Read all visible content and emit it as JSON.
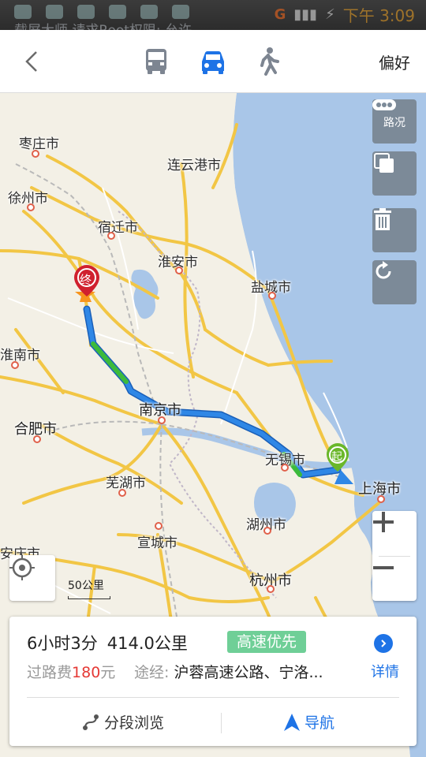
{
  "status_bar": {
    "ticker": "载屏大师 请求Root权限: 允许",
    "time": "下午 3:09",
    "network": "G"
  },
  "topnav": {
    "modes": [
      "bus-icon",
      "car-icon",
      "walk-icon"
    ],
    "active_mode": "car",
    "preference_label": "偏好",
    "accent": "#1e73e6"
  },
  "map": {
    "cities": {
      "zaozhuang": "枣庄市",
      "lianyungang": "连云港市",
      "xuzhou": "徐州市",
      "suqian": "宿迁市",
      "huaian": "淮安市",
      "yancheng": "盐城市",
      "huainan": "淮南市",
      "nanjing": "南京市",
      "hefei": "合肥市",
      "wuxi": "无锡市",
      "shanghai": "上海市",
      "wuhu": "芜湖市",
      "huzhou": "湖州市",
      "xuancheng": "宣城市",
      "anqing": "安庆市",
      "hangzhou": "杭州市"
    },
    "start_marker": "起",
    "end_marker": "终",
    "scale_label": "50公里",
    "tools": {
      "traffic_label": "路况"
    },
    "route_color": "#2f87e6",
    "fast_segment_color": "#3cba3c"
  },
  "route_card": {
    "duration": "6小时3分",
    "distance": "414.0公里",
    "tag": "高速优先",
    "toll_label": "过路费",
    "toll_value": "180",
    "toll_unit": "元",
    "via_label": "途经:",
    "via_roads": "沪蓉高速公路、宁洛...",
    "detail_label": "详情",
    "browse_label": "分段浏览",
    "navigate_label": "导航"
  }
}
